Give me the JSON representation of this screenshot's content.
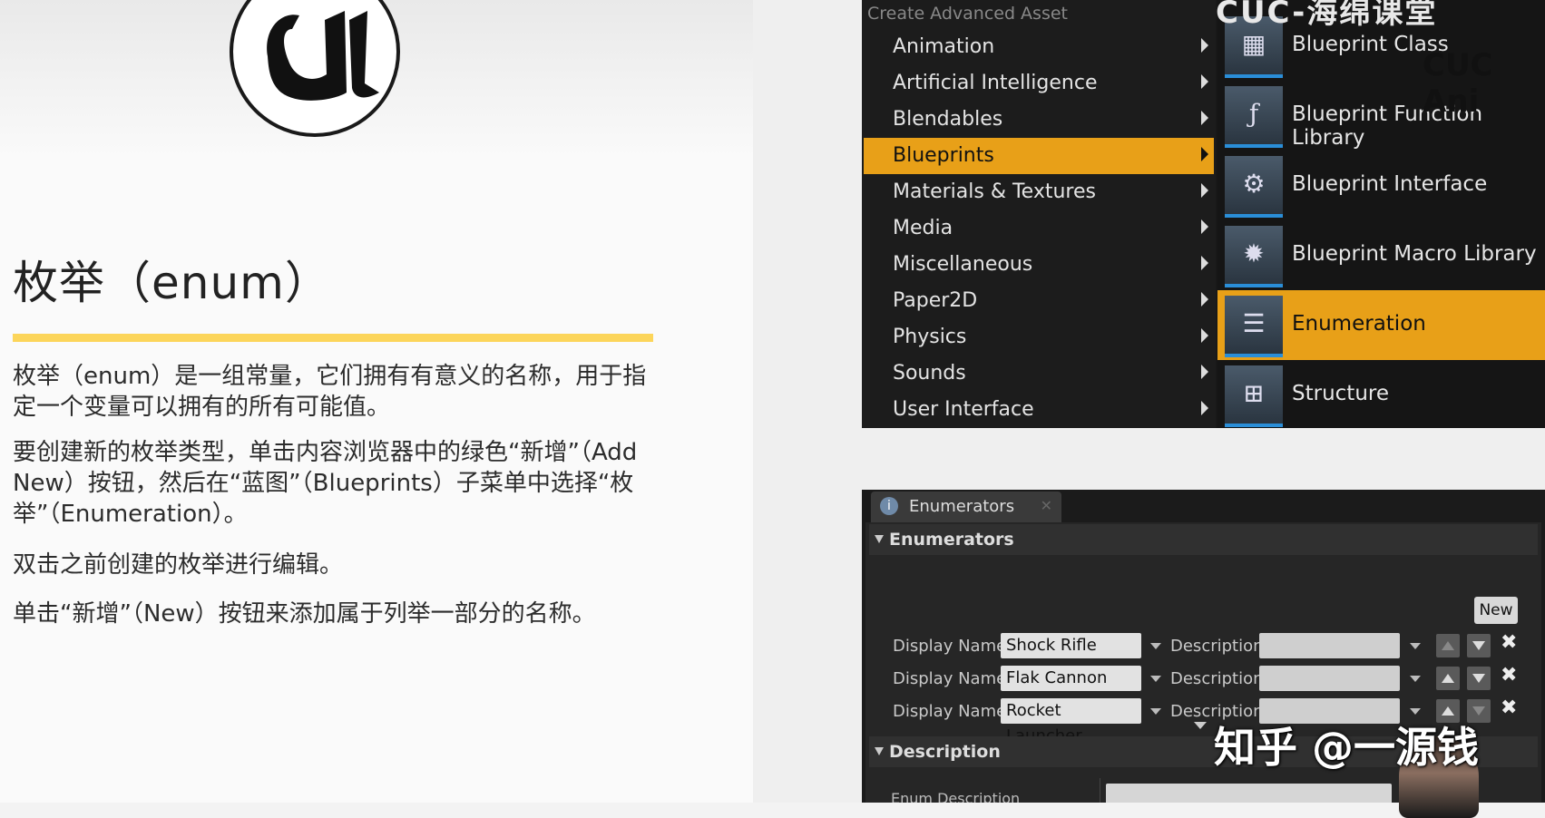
{
  "slide": {
    "title": "枚举（enum）",
    "paragraphs": [
      "枚举（enum）是一组常量，它们拥有有意义的名称，用于指定一个变量可以拥有的所有可能值。",
      "要创建新的枚举类型，单击内容浏览器中的绿色“新增”（Add New）按钮，然后在“蓝图”（Blueprints）子菜单中选择“枚举”（Enumeration）。",
      "双击之前创建的枚举进行编辑。",
      "单击“新增”（New）按钮来添加属于列举一部分的名称。"
    ],
    "accent_color": "#fcd55a"
  },
  "menu": {
    "header": "Create Advanced Asset",
    "items": [
      {
        "label": "Animation"
      },
      {
        "label": "Artificial Intelligence"
      },
      {
        "label": "Blendables"
      },
      {
        "label": "Blueprints"
      },
      {
        "label": "Materials & Textures"
      },
      {
        "label": "Media"
      },
      {
        "label": "Miscellaneous"
      },
      {
        "label": "Paper2D"
      },
      {
        "label": "Physics"
      },
      {
        "label": "Sounds"
      },
      {
        "label": "User Interface"
      }
    ],
    "active_item": "Blueprints",
    "active_color": "#e8a018",
    "submenu": [
      {
        "label": "Blueprint Class",
        "icon": "map-icon"
      },
      {
        "label": "Blueprint Function Library",
        "icon": "function-icon"
      },
      {
        "label": "Blueprint Interface",
        "icon": "interface-icon"
      },
      {
        "label": "Blueprint Macro Library",
        "icon": "gear-icon"
      },
      {
        "label": "Enumeration",
        "icon": "document-list-icon"
      },
      {
        "label": "Structure",
        "icon": "structure-icon"
      }
    ],
    "active_submenu": "Enumeration"
  },
  "watermarks": {
    "top": "CUC-海绵课堂",
    "brand": "CUC Ani",
    "zhihu": "知乎 @一源钱"
  },
  "enum_panel": {
    "tab_label": "Enumerators",
    "section_label": "Enumerators",
    "new_button": "New",
    "display_name_label": "Display Name",
    "description_label": "Description",
    "rows": [
      {
        "display_name": "Shock Rifle",
        "description": ""
      },
      {
        "display_name": "Flak Cannon",
        "description": ""
      },
      {
        "display_name": "Rocket Launcher",
        "description": ""
      }
    ],
    "description_section": "Description",
    "enum_description_label": "Enum Description",
    "enum_description_value": ""
  }
}
